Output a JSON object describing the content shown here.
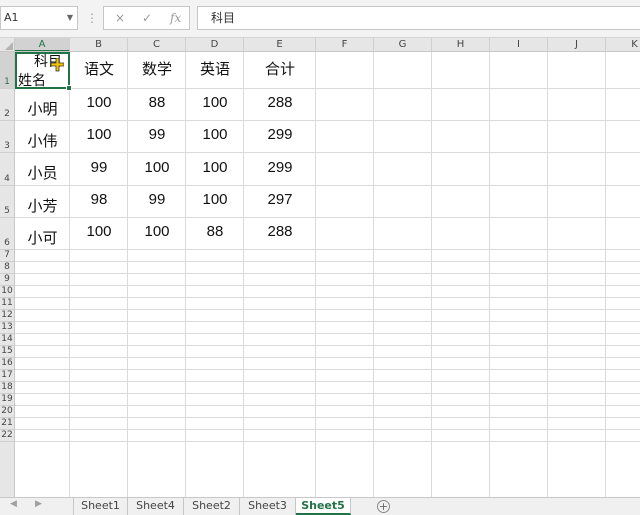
{
  "formula_bar": {
    "name_box": "A1",
    "cancel_icon": "×",
    "enter_icon": "✓",
    "fx_label": "fx",
    "content": "科目"
  },
  "columns": [
    "A",
    "B",
    "C",
    "D",
    "E",
    "F",
    "G",
    "H",
    "I",
    "J",
    "K"
  ],
  "rows": [
    "1",
    "2",
    "3",
    "4",
    "5",
    "6",
    "7",
    "8",
    "9",
    "10",
    "11",
    "12",
    "13",
    "14",
    "15",
    "16",
    "17",
    "18",
    "19",
    "20",
    "21",
    "22"
  ],
  "header_cell": {
    "top": "科目",
    "bottom": "姓名"
  },
  "table": {
    "headers": [
      "语文",
      "数学",
      "英语",
      "合计"
    ],
    "records": [
      {
        "name": "小明",
        "values": [
          "100",
          "88",
          "100",
          "288"
        ]
      },
      {
        "name": "小伟",
        "values": [
          "100",
          "99",
          "100",
          "299"
        ]
      },
      {
        "name": "小员",
        "values": [
          "99",
          "100",
          "100",
          "299"
        ]
      },
      {
        "name": "小芳",
        "values": [
          "98",
          "99",
          "100",
          "297"
        ]
      },
      {
        "name": "小可",
        "values": [
          "100",
          "100",
          "88",
          "288"
        ]
      }
    ]
  },
  "sheet_tabs": [
    {
      "label": "Sheet1",
      "active": false
    },
    {
      "label": "Sheet4",
      "active": false
    },
    {
      "label": "Sheet2",
      "active": false
    },
    {
      "label": "Sheet3",
      "active": false
    },
    {
      "label": "Sheet5",
      "active": true
    }
  ],
  "add_sheet_label": "+",
  "colors": {
    "accent": "#217346",
    "header_bg": "#e6e6e6",
    "gridline": "#dadada"
  },
  "icons": [
    "dropdown-icon",
    "cancel-icon",
    "enter-icon",
    "function-icon",
    "move-cursor-icon",
    "add-sheet-icon"
  ]
}
